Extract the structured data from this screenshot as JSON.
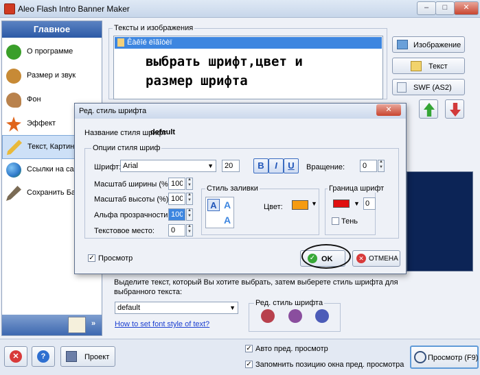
{
  "window": {
    "title": "Aleo Flash Intro Banner Maker",
    "controls": {
      "minimize": "–",
      "maximize": "□",
      "close": "✕"
    }
  },
  "sidebar": {
    "header": "Главное",
    "items": [
      {
        "label": "О программе",
        "icon": "info-icon",
        "color": "#3a9f2a"
      },
      {
        "label": "Размер и звук",
        "icon": "cookie-icon",
        "color": "#c78a36"
      },
      {
        "label": "Фон",
        "icon": "palette-icon",
        "color": "#b9824d"
      },
      {
        "label": "Эффект",
        "icon": "sparkle-icon",
        "color": "#e0651c"
      },
      {
        "label": "Текст, Картинк",
        "icon": "pencil-icon",
        "color": "#e9b93a"
      },
      {
        "label": "Ссылки на сайт",
        "icon": "globe-icon",
        "color": "#2e78c8"
      },
      {
        "label": "Сохранить Банн",
        "icon": "brush-icon",
        "color": "#7a6b55"
      }
    ],
    "footer_expand": "»"
  },
  "texts_panel": {
    "group_label": "Тексты и изображения",
    "list_item": "Êàêîé ëîãîòèï",
    "annotation_line1": "выбрать шрифт,цвет и",
    "annotation_line2": "размер шрифта",
    "buttons": {
      "image": "Изображение",
      "text": "Текст",
      "swf": "SWF (AS2)"
    }
  },
  "bottom_info": {
    "instruction": "Выделите текст, который Вы хотите выбрать, затем выберете стиль шрифта для выбранного текста:",
    "style_select_value": "default",
    "help_link": "How to set font style of text?",
    "edit_group_label": "Ред. стиль шрифта"
  },
  "statusbar": {
    "project_button": "Проект",
    "auto_preview": "Авто пред. просмотр",
    "remember_position": "Запомнить позицию окна пред. просмотра",
    "preview_button": "Просмотр (F9)"
  },
  "dialog": {
    "title": "Ред. стиль шрифта",
    "style_name_label": "Название стиля шрифт",
    "style_name_value": "default",
    "options_group": "Опции стиля шриф",
    "font_label": "Шрифт:",
    "font_value": "Arial",
    "font_size": "20",
    "bold": "B",
    "italic": "I",
    "underline": "U",
    "rotation_label": "Вращение:",
    "rotation_value": "0",
    "width_scale_label": "Масштаб ширины (%):",
    "width_scale_value": "100",
    "height_scale_label": "Масштаб высоты (%):",
    "height_scale_value": "100",
    "alpha_label": "Альфа прозрачности(%)",
    "alpha_value": "100",
    "spacing_label": "Текстовое место:",
    "spacing_value": "0",
    "fill_group": "Стиль заливки",
    "color_label": "Цвет:",
    "fill_color": "#f59b12",
    "border_group": "Граница шрифт",
    "border_color": "#e01010",
    "border_width": "0",
    "shadow_label": "Тень",
    "preview_label": "Просмотр",
    "ok_label": "OK",
    "cancel_label": "ОТМЕНА"
  },
  "preview_bg_color": "#0c2456"
}
